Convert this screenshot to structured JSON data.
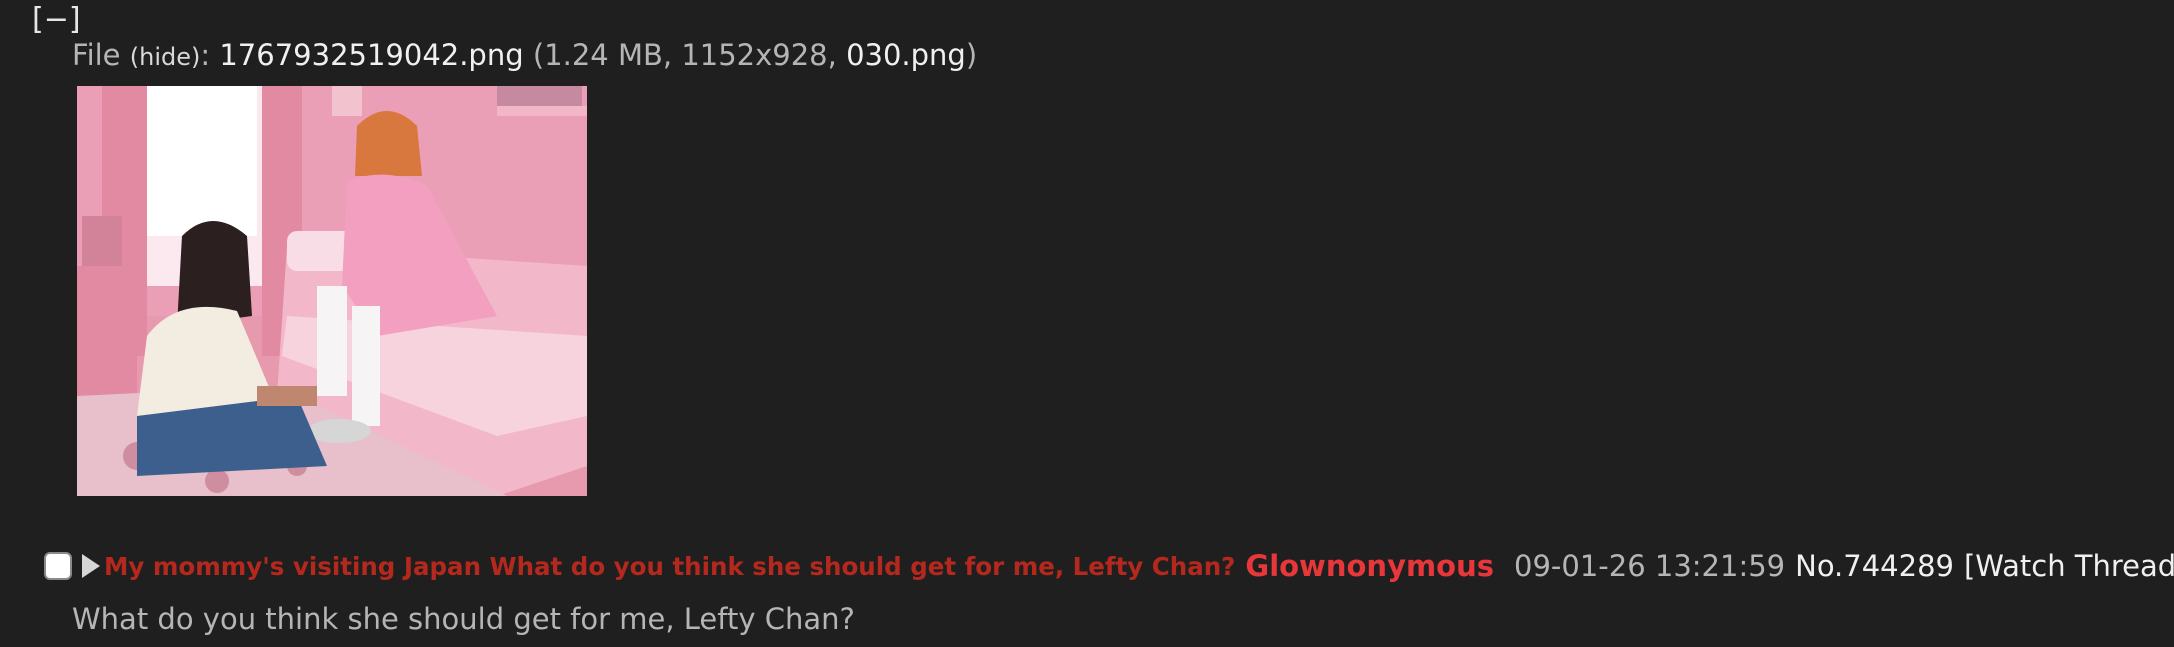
{
  "post": {
    "collapse_label": "[−]",
    "file": {
      "prefix": "File ",
      "hide_label": "(hide)",
      "colon": ": ",
      "filename": "1767932519042.png",
      "meta_open": " (1.24 MB, 1152x928, ",
      "original_name": "030.png",
      "meta_close": ")"
    },
    "subject": "My mommy's visiting Japan What do you think she should get for me, Lefty Chan?",
    "name": "Glownonymous",
    "datetime": "09-01-26 13:21:59",
    "post_number": "No.744289",
    "watch_label": "[Watch Thread]",
    "message": "What do you think she should get for me, Lefty Chan?"
  },
  "colors": {
    "background": "#1f1f1f",
    "subject": "#b5281d",
    "name": "#e8373a",
    "text": "#b5b5b5",
    "link": "#f0f0f0"
  }
}
